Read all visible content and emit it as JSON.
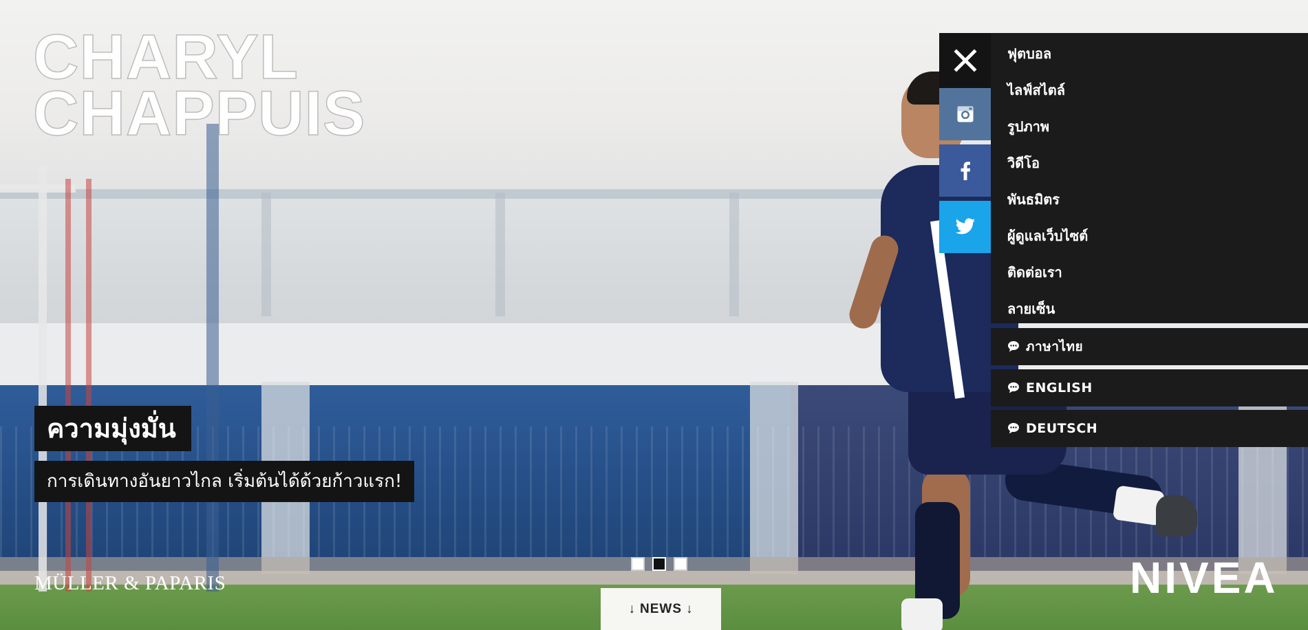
{
  "hero": {
    "name_line1": "CHARYL",
    "name_line2": "CHAPPUIS",
    "tagline": "ความมุ่งมั่น",
    "subline": "การเดินทางอันยาวไกล เริ่มต้นได้ด้วยก้าวแรก!"
  },
  "brands": {
    "left": "MÜLLER & PAPARIS",
    "right": "NIVEA"
  },
  "slider": {
    "total_slides": 3,
    "active_slide": 2
  },
  "news_tab": {
    "label": "NEWS",
    "arrow": "↓"
  },
  "menu": {
    "close_icon": "close-icon",
    "items": [
      {
        "label": "ฟุตบอล"
      },
      {
        "label": "ไลฟ์สไตล์"
      },
      {
        "label": "รูปภาพ"
      },
      {
        "label": "วิดีโอ"
      },
      {
        "label": "พันธมิตร"
      },
      {
        "label": "ผู้ดูแลเว็บไซต์"
      },
      {
        "label": "ติดต่อเรา"
      },
      {
        "label": "ลายเซ็น"
      }
    ],
    "languages": [
      {
        "label": "ภาษาไทย"
      },
      {
        "label": "ENGLISH"
      },
      {
        "label": "DEUTSCH"
      }
    ],
    "social": [
      {
        "icon": "instagram-icon",
        "color": "#52749c"
      },
      {
        "icon": "facebook-icon",
        "color": "#3a5a9b"
      },
      {
        "icon": "twitter-icon",
        "color": "#1aa4e9"
      }
    ]
  },
  "colors": {
    "panel_bg": "#1b1b1b",
    "text_box_bg": "#141414",
    "news_tab_bg": "#f6f6f2"
  }
}
